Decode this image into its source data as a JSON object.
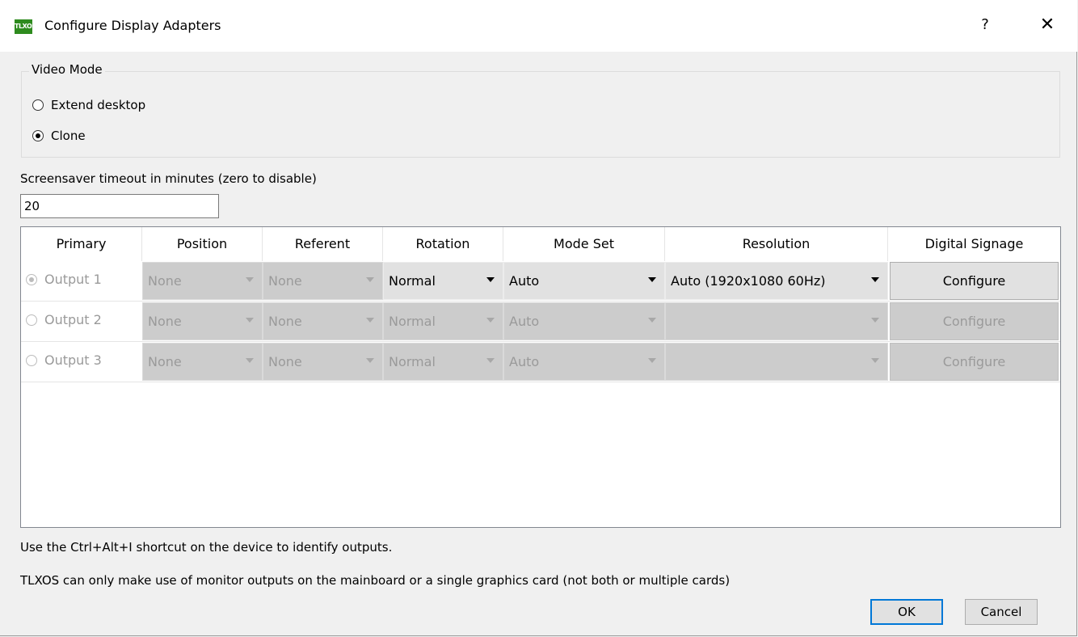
{
  "window": {
    "title": "Configure Display Adapters",
    "app_icon_text": "TLXOS",
    "help_label": "?",
    "close_label": "✕"
  },
  "video_mode": {
    "label": "Video Mode",
    "options": [
      {
        "label": "Extend desktop",
        "selected": false
      },
      {
        "label": "Clone",
        "selected": true
      }
    ]
  },
  "screensaver": {
    "label": "Screensaver timeout in minutes (zero to disable)",
    "value": "20"
  },
  "table": {
    "headers": [
      "Primary",
      "Position",
      "Referent",
      "Rotation",
      "Mode Set",
      "Resolution",
      "Digital Signage"
    ],
    "rows": [
      {
        "output": "Output 1",
        "primary": true,
        "position": "None",
        "referent": "None",
        "rotation": "Normal",
        "mode_set": "Auto",
        "resolution": "Auto (1920x1080 60Hz)",
        "signage": "Configure",
        "enabled": true
      },
      {
        "output": "Output 2",
        "primary": false,
        "position": "None",
        "referent": "None",
        "rotation": "Normal",
        "mode_set": "Auto",
        "resolution": "",
        "signage": "Configure",
        "enabled": false
      },
      {
        "output": "Output 3",
        "primary": false,
        "position": "None",
        "referent": "None",
        "rotation": "Normal",
        "mode_set": "Auto",
        "resolution": "",
        "signage": "Configure",
        "enabled": false
      }
    ]
  },
  "notes": {
    "identify": "Use the Ctrl+Alt+I shortcut on the device to identify outputs.",
    "limitation": "TLXOS can only make use of monitor outputs on the mainboard or a single graphics card (not both or multiple cards)"
  },
  "buttons": {
    "ok": "OK",
    "cancel": "Cancel"
  }
}
